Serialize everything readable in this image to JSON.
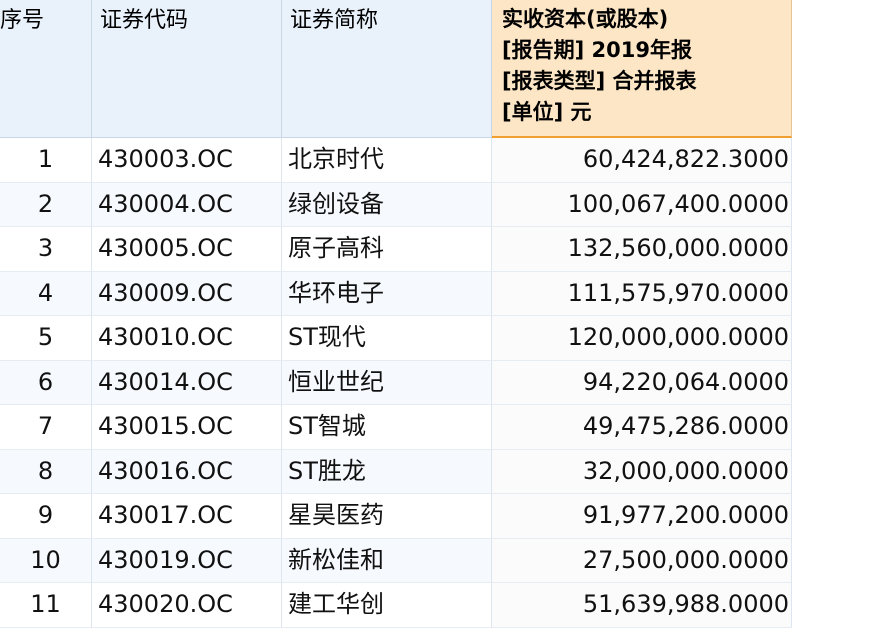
{
  "table": {
    "headers": {
      "index": "序号",
      "code": "证券代码",
      "name": "证券简称",
      "capital_lines": [
        "实收资本(或股本)",
        "[报告期] 2019年报",
        "[报表类型] 合并报表",
        "[单位] 元"
      ]
    },
    "rows": [
      {
        "index": "1",
        "code": "430003.OC",
        "name": "北京时代",
        "capital": "60,424,822.3000"
      },
      {
        "index": "2",
        "code": "430004.OC",
        "name": "绿创设备",
        "capital": "100,067,400.0000"
      },
      {
        "index": "3",
        "code": "430005.OC",
        "name": "原子高科",
        "capital": "132,560,000.0000"
      },
      {
        "index": "4",
        "code": "430009.OC",
        "name": "华环电子",
        "capital": "111,575,970.0000"
      },
      {
        "index": "5",
        "code": "430010.OC",
        "name": "ST现代",
        "capital": "120,000,000.0000"
      },
      {
        "index": "6",
        "code": "430014.OC",
        "name": "恒业世纪",
        "capital": "94,220,064.0000"
      },
      {
        "index": "7",
        "code": "430015.OC",
        "name": "ST智城",
        "capital": "49,475,286.0000"
      },
      {
        "index": "8",
        "code": "430016.OC",
        "name": "ST胜龙",
        "capital": "32,000,000.0000"
      },
      {
        "index": "9",
        "code": "430017.OC",
        "name": "星昊医药",
        "capital": "91,977,200.0000"
      },
      {
        "index": "10",
        "code": "430019.OC",
        "name": "新松佳和",
        "capital": "27,500,000.0000"
      },
      {
        "index": "11",
        "code": "430020.OC",
        "name": "建工华创",
        "capital": "51,639,988.0000"
      }
    ]
  },
  "colors": {
    "header_bg": "#e9f1fb",
    "highlight_header_bg": "#fde6c5",
    "highlight_border": "#f0a030",
    "grid_line": "#dde5ef"
  }
}
